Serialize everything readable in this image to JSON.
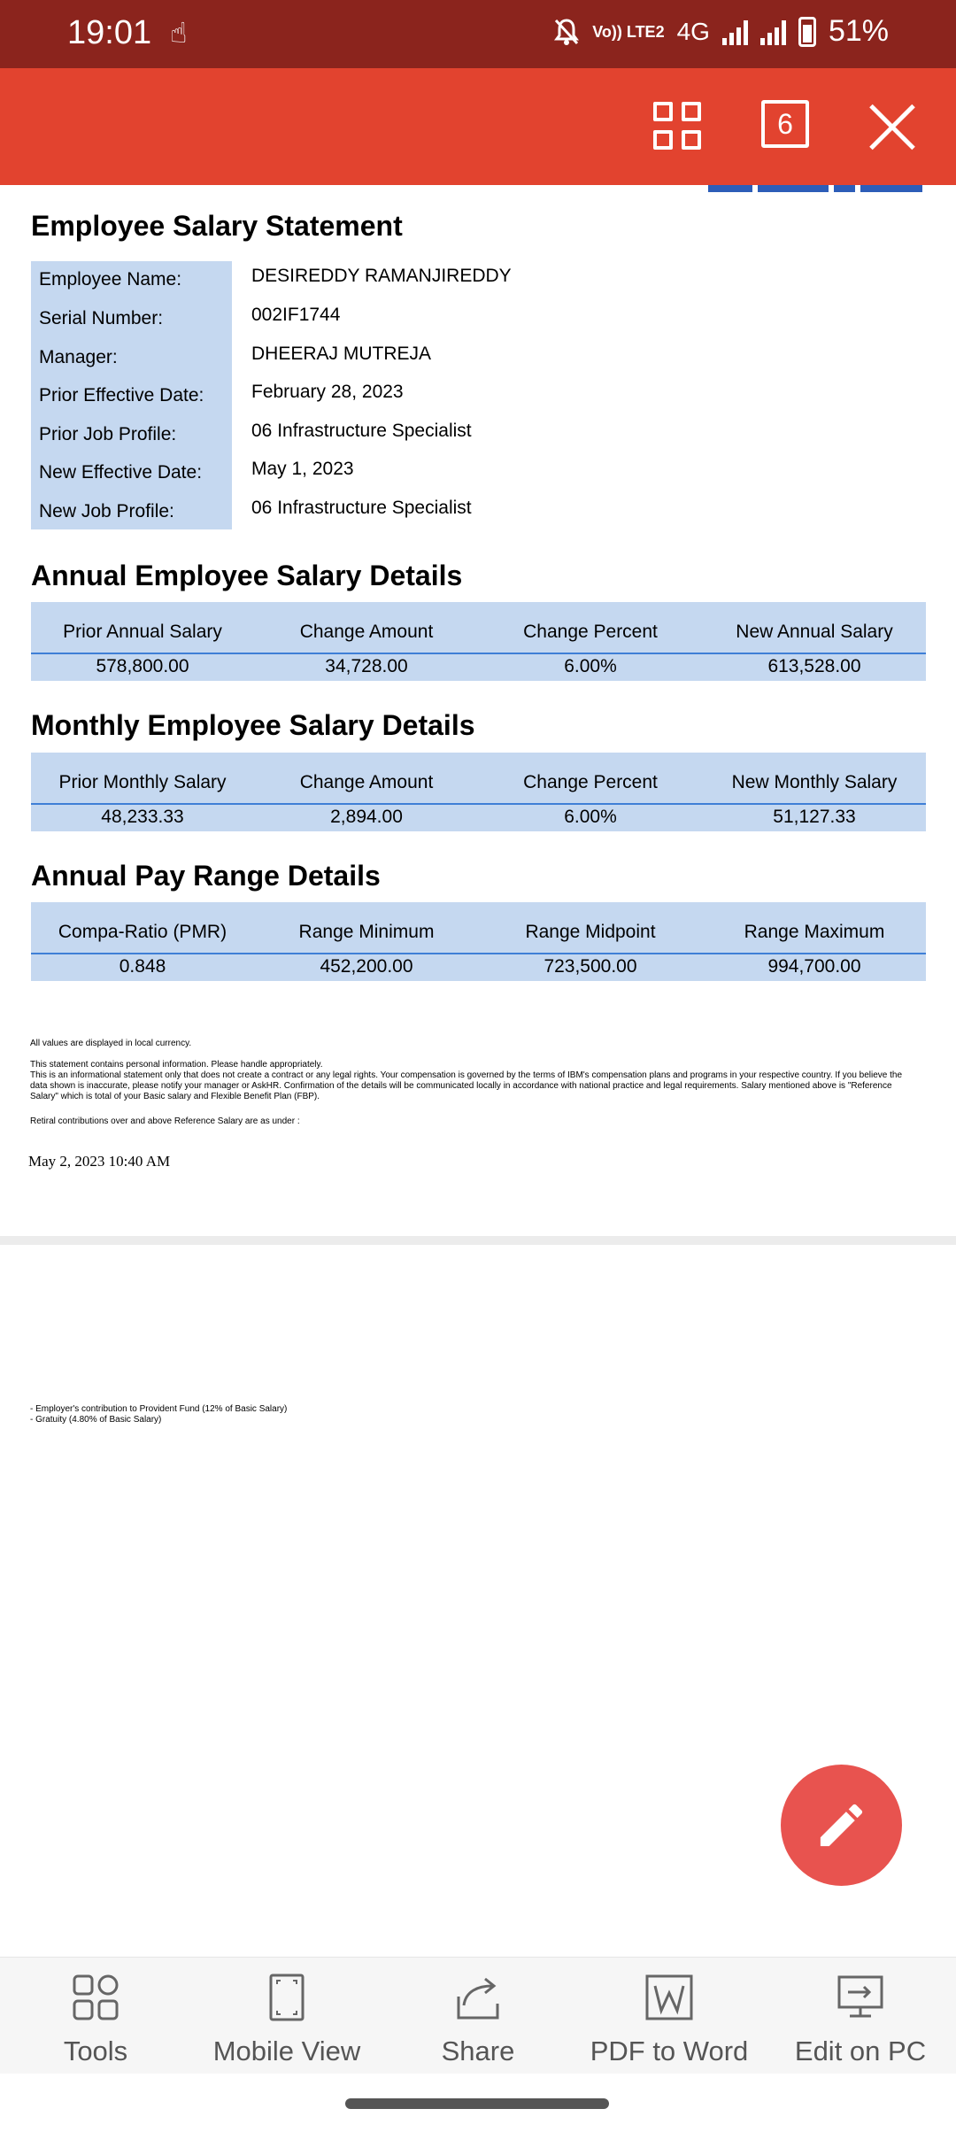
{
  "status_bar": {
    "time": "19:01",
    "network_label": "4G",
    "volte_label": "Vo)) LTE2",
    "battery": "51%",
    "icons": [
      "touch-gesture-icon",
      "mute-icon",
      "signal-icon",
      "battery-icon"
    ]
  },
  "toolbar": {
    "page_count": "6",
    "icons": [
      "grid-view-icon",
      "page-count-icon",
      "close-icon"
    ]
  },
  "document": {
    "title": "Employee Salary Statement",
    "info_rows": [
      {
        "label": "Employee Name:",
        "value": "DESIREDDY RAMANJIREDDY"
      },
      {
        "label": "Serial Number:",
        "value": "002IF1744"
      },
      {
        "label": "Manager:",
        "value": "DHEERAJ MUTREJA"
      },
      {
        "label": "Prior Effective Date:",
        "value": "February 28, 2023"
      },
      {
        "label": "Prior Job Profile:",
        "value": "06 Infrastructure Specialist"
      },
      {
        "label": "New Effective Date:",
        "value": "May 1, 2023"
      },
      {
        "label": "New Job Profile:",
        "value": "06 Infrastructure Specialist"
      }
    ],
    "annual": {
      "title": "Annual Employee Salary Details",
      "headers": [
        "Prior Annual Salary",
        "Change Amount",
        "Change Percent",
        "New Annual Salary"
      ],
      "values": [
        "578,800.00",
        "34,728.00",
        "6.00%",
        "613,528.00"
      ]
    },
    "monthly": {
      "title": "Monthly Employee Salary Details",
      "headers": [
        "Prior Monthly Salary",
        "Change Amount",
        "Change Percent",
        "New Monthly Salary"
      ],
      "values": [
        "48,233.33",
        "2,894.00",
        "6.00%",
        "51,127.33"
      ]
    },
    "pay_range": {
      "title": "Annual Pay Range Details",
      "headers": [
        "Compa-Ratio (PMR)",
        "Range Minimum",
        "Range Midpoint",
        "Range Maximum"
      ],
      "values": [
        "0.848",
        "452,200.00",
        "723,500.00",
        "994,700.00"
      ]
    },
    "note_currency": "All values are displayed in local currency.",
    "note_personal": "This statement contains personal information. Please handle appropriately.",
    "note_info": "This is an informational statement only that does not create a contract or any legal rights. Your compensation is governed by the terms of IBM's compensation plans and programs in your respective country. If you believe the data shown is inaccurate, please notify your manager or AskHR. Confirmation of the details will be communicated locally in accordance with national practice and legal requirements. Salary mentioned above is \"Reference Salary\" which is total of your Basic salary and Flexible Benefit Plan (FBP).",
    "note_retiral": "Retiral contributions over and above Reference Salary are as under :",
    "timestamp": "May 2, 2023 10:40 AM",
    "page2_line1": "- Employer's contribution to Provident Fund (12% of Basic Salary)",
    "page2_line2": "- Gratuity (4.80% of Basic Salary)"
  },
  "fab": {
    "icon": "pencil-icon"
  },
  "bottom_bar": {
    "tools": [
      {
        "label": "Tools",
        "icon": "tools-icon"
      },
      {
        "label": "Mobile View",
        "icon": "mobile-view-icon"
      },
      {
        "label": "Share",
        "icon": "share-icon"
      },
      {
        "label": "PDF to Word",
        "icon": "word-icon"
      },
      {
        "label": "Edit on PC",
        "icon": "pc-icon"
      }
    ]
  },
  "colors": {
    "status_bar": "#8b241d",
    "app_bar": "#e2432f",
    "table_fill": "#c5d8f0",
    "table_rule": "#3f7fd6",
    "fab": "#e8534f"
  }
}
